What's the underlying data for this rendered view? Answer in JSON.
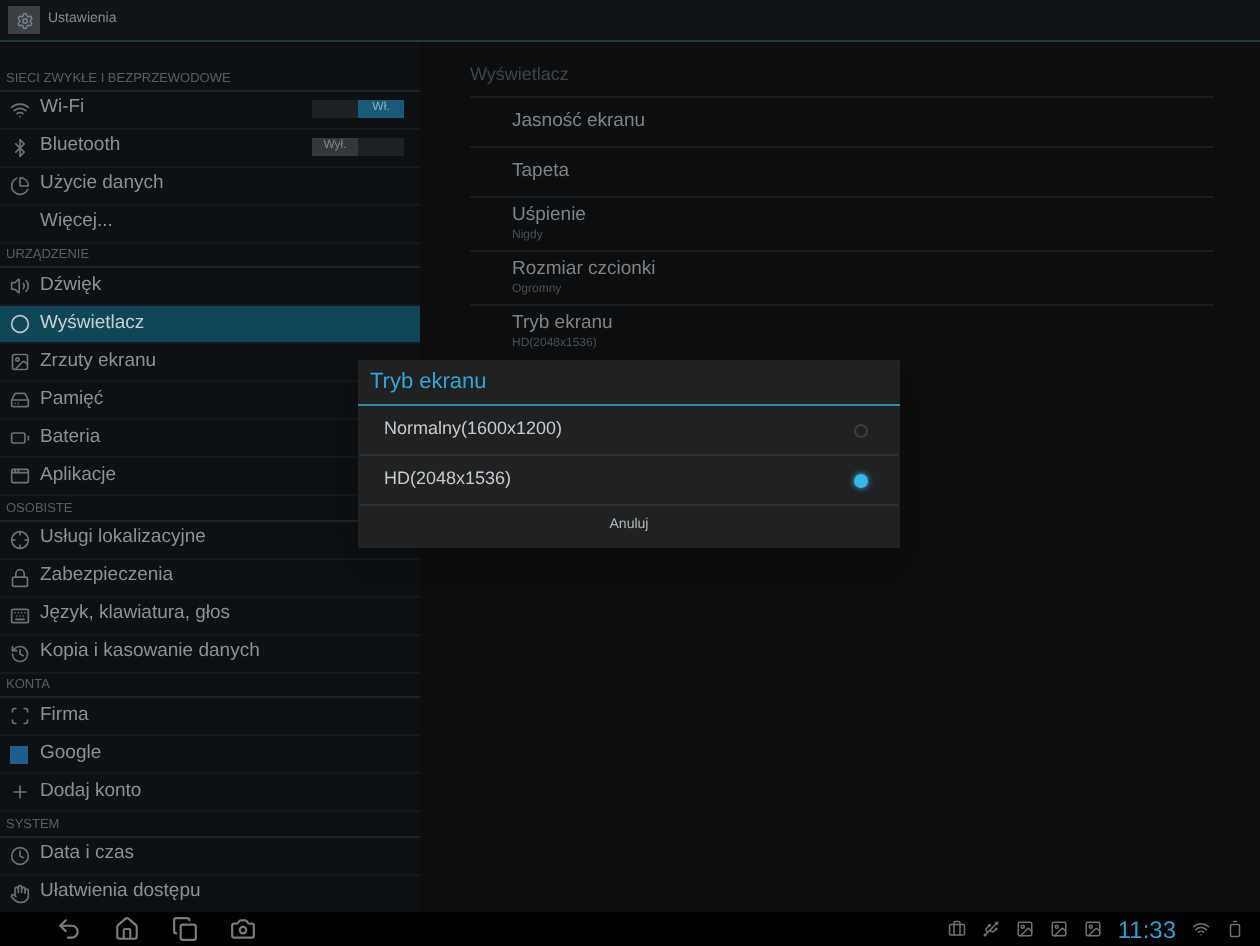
{
  "title_bar": {
    "title": "Ustawienia"
  },
  "sidebar": {
    "items": [
      {
        "kind": "header",
        "label": "SIECI ZWYKŁE I BEZPRZEWODOWE"
      },
      {
        "kind": "toggle",
        "label": "Wi-Fi",
        "switch": "Wł.",
        "on": true,
        "selected": false
      },
      {
        "kind": "toggle",
        "label": "Bluetooth",
        "switch": "Wył.",
        "on": false,
        "selected": false
      },
      {
        "kind": "item",
        "label": "Użycie danych",
        "selected": false
      },
      {
        "kind": "item",
        "label": "Więcej...",
        "selected": false
      },
      {
        "kind": "header",
        "label": "URZĄDZENIE"
      },
      {
        "kind": "item",
        "label": "Dźwięk",
        "selected": false
      },
      {
        "kind": "item",
        "label": "Wyświetlacz",
        "selected": true
      },
      {
        "kind": "item",
        "label": "Zrzuty ekranu",
        "selected": false
      },
      {
        "kind": "item",
        "label": "Pamięć",
        "selected": false
      },
      {
        "kind": "item",
        "label": "Bateria",
        "selected": false
      },
      {
        "kind": "item",
        "label": "Aplikacje",
        "selected": false
      },
      {
        "kind": "header",
        "label": "OSOBISTE"
      },
      {
        "kind": "item",
        "label": "Usługi lokalizacyjne",
        "selected": false
      },
      {
        "kind": "item",
        "label": "Zabezpieczenia",
        "selected": false
      },
      {
        "kind": "item",
        "label": "Język, klawiatura, głos",
        "selected": false
      },
      {
        "kind": "item",
        "label": "Kopia i kasowanie danych",
        "selected": false
      },
      {
        "kind": "header",
        "label": "KONTA"
      },
      {
        "kind": "item",
        "label": "Firma",
        "selected": false
      },
      {
        "kind": "item",
        "label": "Google",
        "selected": false
      },
      {
        "kind": "item",
        "label": "Dodaj konto",
        "selected": false
      },
      {
        "kind": "header",
        "label": "SYSTEM"
      },
      {
        "kind": "item",
        "label": "Data i czas",
        "selected": false
      },
      {
        "kind": "item",
        "label": "Ułatwienia dostępu",
        "selected": false
      }
    ]
  },
  "content": {
    "title": "Wyświetlacz",
    "items": [
      {
        "label": "Jasność ekranu"
      },
      {
        "label": "Tapeta"
      },
      {
        "label": "Uśpienie",
        "summary": "Nigdy"
      },
      {
        "label": "Rozmiar czcionki",
        "summary": "Ogromny"
      },
      {
        "label": "Tryb ekranu",
        "summary": "HD(2048x1536)"
      }
    ]
  },
  "dialog": {
    "title": "Tryb ekranu",
    "options": [
      {
        "label": "Normalny(1600x1200)",
        "selected": false
      },
      {
        "label": "HD(2048x1536)",
        "selected": true
      }
    ],
    "button": "Anuluj"
  },
  "status_bar": {
    "time": "11:33"
  }
}
